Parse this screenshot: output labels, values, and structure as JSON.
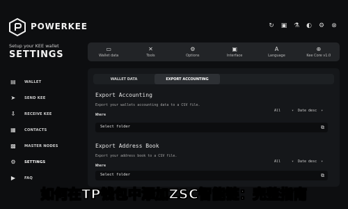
{
  "app": {
    "brand": "POWERKEE",
    "settings_subtitle": "Setup your KEE wallet",
    "settings_title": "SETTINGS"
  },
  "header_icons": [
    {
      "name": "refresh-icon",
      "glyph": "↻"
    },
    {
      "name": "gift-icon",
      "glyph": "▣"
    },
    {
      "name": "flask-icon",
      "glyph": "⚗"
    },
    {
      "name": "theme-icon",
      "glyph": "◐"
    },
    {
      "name": "settings-icon",
      "glyph": "⚙"
    },
    {
      "name": "close-icon",
      "glyph": "⊗"
    }
  ],
  "sidebar": {
    "items": [
      {
        "label": "WALLET",
        "icon": "wallet-icon",
        "glyph": "▤",
        "active": false
      },
      {
        "label": "SEND KEE",
        "icon": "send-icon",
        "glyph": "➤",
        "active": false
      },
      {
        "label": "RECEIVE KEE",
        "icon": "receive-icon",
        "glyph": "⇩",
        "active": false
      },
      {
        "label": "CONTACTS",
        "icon": "contacts-icon",
        "glyph": "▦",
        "active": false
      },
      {
        "label": "MASTER NODES",
        "icon": "masternodes-icon",
        "glyph": "▩",
        "active": false
      },
      {
        "label": "SETTINGS",
        "icon": "settings-icon",
        "glyph": "⚙",
        "active": true
      },
      {
        "label": "FAQ",
        "icon": "faq-icon",
        "glyph": "▶",
        "active": false
      }
    ]
  },
  "toolbar": {
    "items": [
      {
        "label": "Wallet data",
        "icon": "wallet-data-icon",
        "glyph": "▭"
      },
      {
        "label": "Tools",
        "icon": "tools-icon",
        "glyph": "✕"
      },
      {
        "label": "Options",
        "icon": "options-icon",
        "glyph": "⚙"
      },
      {
        "label": "Interface",
        "icon": "interface-icon",
        "glyph": "▣"
      },
      {
        "label": "Language",
        "icon": "language-icon",
        "glyph": "A"
      },
      {
        "label": "Kee Core v1.0",
        "icon": "kee-core-icon",
        "glyph": "⊕"
      }
    ]
  },
  "tabs": [
    {
      "label": "WALLET DATA",
      "active": false
    },
    {
      "label": "EXPORT ACCOUNTING",
      "active": true
    }
  ],
  "export_accounting": {
    "title": "Export Accounting",
    "description": "Export your wallets accounting data to a CSV file.",
    "where_label": "Where",
    "filter_all": "All",
    "filter_sort": "Date desc",
    "folder_text": "Select folder"
  },
  "export_address_book": {
    "title": "Export Address Book",
    "description": "Export your address book to a CSV file.",
    "where_label": "Where",
    "filter_all": "All",
    "filter_sort": "Date desc",
    "folder_text": "Select folder"
  },
  "caption": "如何在TP钱包中添加ZSC智能链：完整指南"
}
